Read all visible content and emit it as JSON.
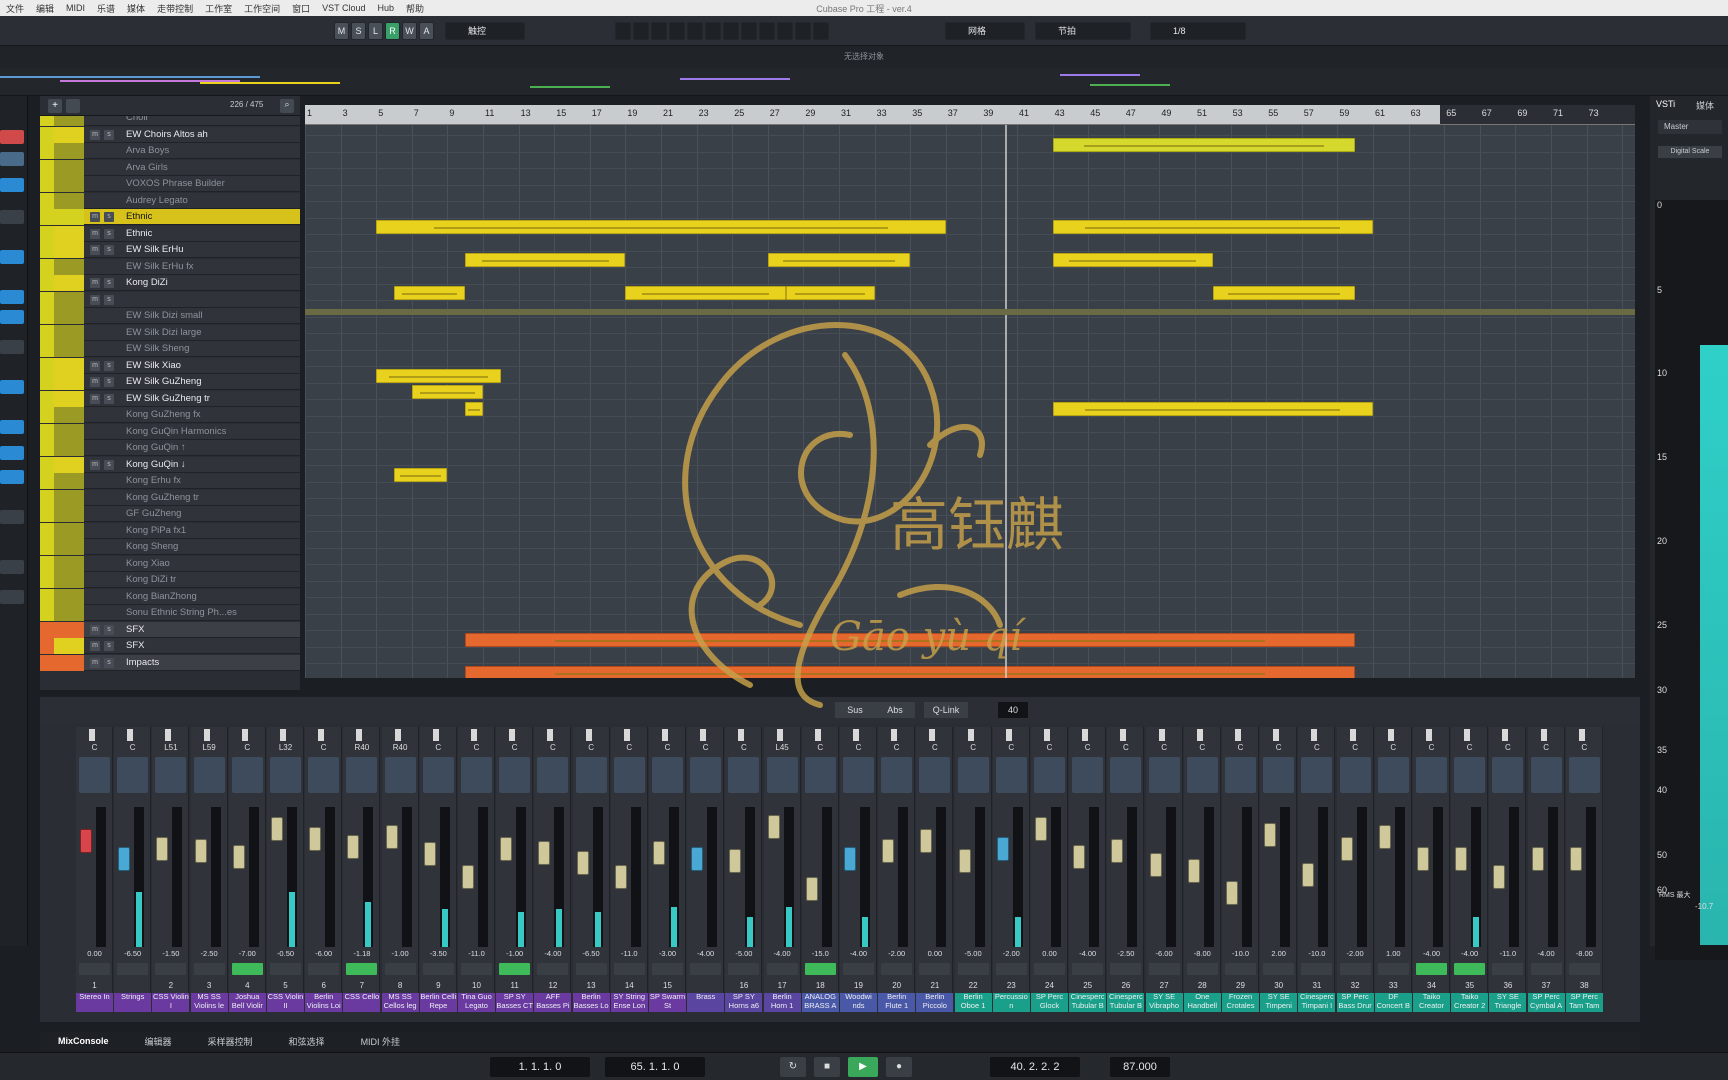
{
  "menu": [
    "文件",
    "编辑",
    "MIDI",
    "乐谱",
    "媒体",
    "走带控制",
    "工作室",
    "工作空间",
    "窗口",
    "VST Cloud",
    "Hub",
    "帮助"
  ],
  "window_title": "Cubase Pro 工程 - ver.4",
  "toolbar": {
    "ms": [
      "M",
      "S",
      "L",
      "R",
      "W",
      "A"
    ],
    "auto_mode": "触控",
    "snap": "网格",
    "snap_type": "节拍",
    "quant": "1/8"
  },
  "info_line": "无选择对象",
  "track_header": {
    "count": "226 / 475"
  },
  "tracks": [
    {
      "name": "Choir",
      "type": "hid"
    },
    {
      "name": "EW Choirs Altos ah",
      "type": "main",
      "num": "46"
    },
    {
      "name": "Arva Boys",
      "type": "hid"
    },
    {
      "name": "Arva Girls",
      "type": "hid"
    },
    {
      "name": "VOXOS Phrase Builder",
      "type": "hid"
    },
    {
      "name": "Audrey Legato",
      "type": "hid"
    },
    {
      "name": "Ethnic",
      "type": "folder"
    },
    {
      "name": "Ethnic",
      "type": "main",
      "num": "49"
    },
    {
      "name": "EW Silk ErHu",
      "type": "main",
      "num": "50"
    },
    {
      "name": "EW Silk ErHu fx",
      "type": "hid"
    },
    {
      "name": "Kong DiZi",
      "type": "main",
      "num": "51"
    },
    {
      "name": "",
      "type": "rec"
    },
    {
      "name": "EW Silk Dizi small",
      "type": "hid"
    },
    {
      "name": "EW Silk Dizi large",
      "type": "hid"
    },
    {
      "name": "EW Silk Sheng",
      "type": "hid"
    },
    {
      "name": "EW Silk Xiao",
      "type": "main",
      "num": "52"
    },
    {
      "name": "EW Silk GuZheng",
      "type": "main",
      "num": "53"
    },
    {
      "name": "EW Silk GuZheng tr",
      "type": "main",
      "num": "54"
    },
    {
      "name": "Kong GuZheng fx",
      "type": "hid"
    },
    {
      "name": "Kong GuQin Harmonics",
      "type": "hid"
    },
    {
      "name": "Kong GuQin ↑",
      "type": "hid"
    },
    {
      "name": "Kong GuQin ↓",
      "type": "main",
      "num": "55"
    },
    {
      "name": "Kong Erhu fx",
      "type": "hid"
    },
    {
      "name": "Kong GuZheng tr",
      "type": "hid"
    },
    {
      "name": "GF GuZheng",
      "type": "hid"
    },
    {
      "name": "Kong PiPa fx1",
      "type": "hid"
    },
    {
      "name": "Kong Sheng",
      "type": "hid"
    },
    {
      "name": "Kong Xiao",
      "type": "hid"
    },
    {
      "name": "Kong DiZi tr",
      "type": "hid"
    },
    {
      "name": "Kong BianZhong",
      "type": "hid"
    },
    {
      "name": "Sonu Ethnic String Ph...es",
      "type": "hid"
    },
    {
      "name": "SFX",
      "type": "sfxfolder"
    },
    {
      "name": "SFX",
      "type": "main",
      "num": "56"
    },
    {
      "name": "Impacts",
      "type": "sfxfolder"
    }
  ],
  "ruler_marks": [
    "1",
    "3",
    "5",
    "7",
    "9",
    "11",
    "13",
    "15",
    "17",
    "19",
    "21",
    "23",
    "25",
    "27",
    "29",
    "31",
    "33",
    "35",
    "37",
    "39",
    "41",
    "43",
    "45",
    "47",
    "49",
    "51",
    "53",
    "55",
    "57",
    "59",
    "61",
    "63",
    "65",
    "67",
    "69",
    "71",
    "73"
  ],
  "mixer_toolbar": {
    "sus": "Sus",
    "abs": "Abs",
    "qlink": "Q-Link",
    "count": "40"
  },
  "channels": [
    {
      "n": "1",
      "name": "Stereo In",
      "pan": "C",
      "vol": "0.00",
      "fader": 22,
      "meter": 0,
      "style": "r"
    },
    {
      "n": "",
      "name": "Strings",
      "pan": "C",
      "vol": "-6.50",
      "fader": 40,
      "meter": 55,
      "style": "b"
    },
    {
      "n": "2",
      "name": "CSS Violin I",
      "pan": "L51",
      "vol": "-1.50",
      "fader": 30,
      "meter": 0
    },
    {
      "n": "3",
      "name": "MS SS Violins le",
      "pan": "L59",
      "vol": "-2.50",
      "fader": 32,
      "meter": 0
    },
    {
      "n": "4",
      "name": "Joshua Bell Violir",
      "pan": "C",
      "vol": "-7.00",
      "fader": 38,
      "meter": 0,
      "green": true
    },
    {
      "n": "5",
      "name": "CSS Violin II",
      "pan": "L32",
      "vol": "-0.50",
      "fader": 10,
      "meter": 55
    },
    {
      "n": "6",
      "name": "Berlin Violins Loi",
      "pan": "C",
      "vol": "-6.00",
      "fader": 20,
      "meter": 0
    },
    {
      "n": "7",
      "name": "CSS Cello",
      "pan": "R40",
      "vol": "-1.18",
      "fader": 28,
      "meter": 45,
      "green": true
    },
    {
      "n": "8",
      "name": "MS SS Cellos leg",
      "pan": "R40",
      "vol": "-1.00",
      "fader": 18,
      "meter": 0
    },
    {
      "n": "9",
      "name": "Berlin Celli Repe",
      "pan": "C",
      "vol": "-3.50",
      "fader": 35,
      "meter": 38
    },
    {
      "n": "10",
      "name": "Tina Guo Legato",
      "pan": "C",
      "vol": "-11.0",
      "fader": 58,
      "meter": 0
    },
    {
      "n": "11",
      "name": "SP SY Basses CT",
      "pan": "C",
      "vol": "-1.00",
      "fader": 30,
      "meter": 35,
      "green": true
    },
    {
      "n": "12",
      "name": "AFF Basses Pi",
      "pan": "C",
      "vol": "-4.00",
      "fader": 34,
      "meter": 38
    },
    {
      "n": "13",
      "name": "Berlin Basses Lo",
      "pan": "C",
      "vol": "-6.50",
      "fader": 44,
      "meter": 35
    },
    {
      "n": "14",
      "name": "SY String Ense Lon",
      "pan": "C",
      "vol": "-11.0",
      "fader": 58,
      "meter": 0
    },
    {
      "n": "15",
      "name": "SP Swarm St",
      "pan": "C",
      "vol": "-3.00",
      "fader": 34,
      "meter": 40
    },
    {
      "n": "",
      "name": "Brass",
      "pan": "C",
      "vol": "-4.00",
      "fader": 40,
      "meter": 0,
      "style": "b"
    },
    {
      "n": "16",
      "name": "SP SY Horns a6",
      "pan": "C",
      "vol": "-5.00",
      "fader": 42,
      "meter": 30
    },
    {
      "n": "17",
      "name": "Berlin Horn 1",
      "pan": "L45",
      "vol": "-4.00",
      "fader": 8,
      "meter": 40
    },
    {
      "n": "18",
      "name": "ANALOG BRASS A",
      "pan": "C",
      "vol": "-15.0",
      "fader": 70,
      "meter": 0,
      "green": true
    },
    {
      "n": "19",
      "name": "Woodwi nds",
      "pan": "C",
      "vol": "-4.00",
      "fader": 40,
      "meter": 30,
      "style": "b"
    },
    {
      "n": "20",
      "name": "Berlin Flute 1",
      "pan": "C",
      "vol": "-2.00",
      "fader": 32,
      "meter": 0
    },
    {
      "n": "21",
      "name": "Berlin Piccolo",
      "pan": "C",
      "vol": "0.00",
      "fader": 22,
      "meter": 0
    },
    {
      "n": "22",
      "name": "Berlin Oboe 1",
      "pan": "C",
      "vol": "-5.00",
      "fader": 42,
      "meter": 0
    },
    {
      "n": "23",
      "name": "Percussio n",
      "pan": "C",
      "vol": "-2.00",
      "fader": 30,
      "meter": 30,
      "style": "b"
    },
    {
      "n": "24",
      "name": "SP Perc Glock",
      "pan": "C",
      "vol": "0.00",
      "fader": 10,
      "meter": 0
    },
    {
      "n": "25",
      "name": "Cinesperc Tubular B",
      "pan": "C",
      "vol": "-4.00",
      "fader": 38,
      "meter": 0
    },
    {
      "n": "26",
      "name": "Cinesperc Tubular B",
      "pan": "C",
      "vol": "-2.50",
      "fader": 32,
      "meter": 0
    },
    {
      "n": "27",
      "name": "SY SE Vibrapho",
      "pan": "C",
      "vol": "-6.00",
      "fader": 46,
      "meter": 0
    },
    {
      "n": "28",
      "name": "One Handbell",
      "pan": "C",
      "vol": "-8.00",
      "fader": 52,
      "meter": 0
    },
    {
      "n": "29",
      "name": "Frozen Crotales",
      "pan": "C",
      "vol": "-10.0",
      "fader": 74,
      "meter": 0
    },
    {
      "n": "30",
      "name": "SY SE Timpeni",
      "pan": "C",
      "vol": "2.00",
      "fader": 16,
      "meter": 0
    },
    {
      "n": "31",
      "name": "Cinesperc Timpani I",
      "pan": "C",
      "vol": "-10.0",
      "fader": 56,
      "meter": 0
    },
    {
      "n": "32",
      "name": "SP Perc Bass Drur",
      "pan": "C",
      "vol": "-2.00",
      "fader": 30,
      "meter": 0
    },
    {
      "n": "33",
      "name": "DF Concert B",
      "pan": "C",
      "vol": "1.00",
      "fader": 18,
      "meter": 0
    },
    {
      "n": "34",
      "name": "Taiko Creator",
      "pan": "C",
      "vol": "-4.00",
      "fader": 40,
      "meter": 0,
      "green": true
    },
    {
      "n": "35",
      "name": "Taiko Creator 2",
      "pan": "C",
      "vol": "-4.00",
      "fader": 40,
      "meter": 30,
      "green": true
    },
    {
      "n": "36",
      "name": "SY SE Triangle",
      "pan": "C",
      "vol": "-11.0",
      "fader": 58,
      "meter": 0
    },
    {
      "n": "37",
      "name": "SP Perc Cymbal A",
      "pan": "C",
      "vol": "-4.00",
      "fader": 40,
      "meter": 0
    },
    {
      "n": "38",
      "name": "SP Perc Tam Tam",
      "pan": "C",
      "vol": "-8.00",
      "fader": 40,
      "meter": 0
    }
  ],
  "mixer_tabs": [
    "MixConsole",
    "编辑器",
    "采样器控制",
    "和弦选择",
    "MIDI 外挂"
  ],
  "right_panel": {
    "tabs": [
      "VSTi",
      "媒体"
    ],
    "master": "Master",
    "scale": "Digital Scale",
    "ticks": [
      "0",
      "5",
      "10",
      "15",
      "20",
      "25",
      "30",
      "35",
      "40",
      "50",
      "60"
    ],
    "rms_label": "RMS 最大",
    "rms_value": "-10.7"
  },
  "transport": {
    "left_locator": "1. 1. 1. 0",
    "right_locator": "65. 1. 1. 0",
    "position": "40. 2. 2. 2",
    "tempo": "87.000"
  },
  "watermark": {
    "cn": "高钰麒",
    "pinyin": "Gāo yù qí"
  }
}
